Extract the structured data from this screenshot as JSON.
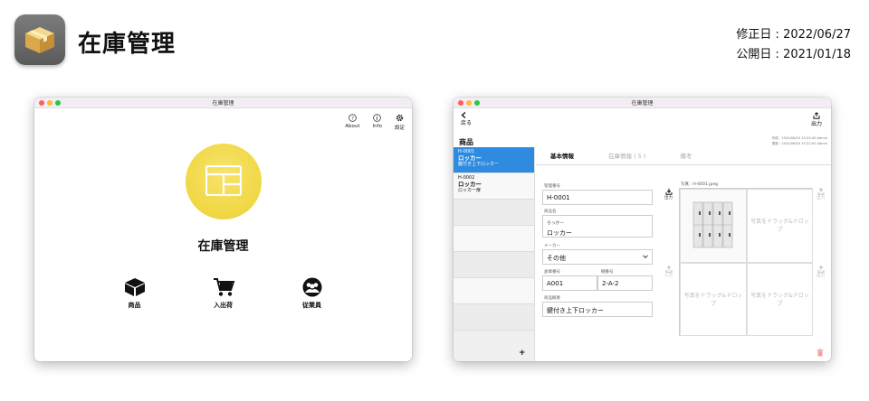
{
  "header": {
    "app_title": "在庫管理",
    "modified": "修正日 : 2022/06/27",
    "published": "公開日 : 2021/01/18"
  },
  "left_window": {
    "title": "在庫管理",
    "toolbar": [
      {
        "label": "About",
        "icon": "question-circle-icon"
      },
      {
        "label": "Info",
        "icon": "info-circle-icon"
      },
      {
        "label": "設定",
        "icon": "gear-icon"
      }
    ],
    "main_label": "在庫管理",
    "nav": [
      {
        "label": "商品",
        "icon": "box-icon"
      },
      {
        "label": "入出荷",
        "icon": "cart-icon"
      },
      {
        "label": "従業員",
        "icon": "people-icon"
      }
    ]
  },
  "right_window": {
    "title": "在庫管理",
    "back_label": "戻る",
    "output_label": "出力",
    "meta_lines": [
      "作成 : 2020/06/03 15:20:40 Admin",
      "更新 : 2020/06/03 15:22:02 Admin"
    ],
    "list_title": "商品",
    "items": [
      {
        "code": "H-0001",
        "name": "ロッカー",
        "desc": "鍵付き上下ロッカー",
        "selected": true
      },
      {
        "code": "H-0002",
        "name": "ロッカー",
        "desc": "ロッカー扉",
        "selected": false
      }
    ],
    "add_label": "+",
    "tabs": [
      "基本情報",
      "在庫情報 ( 5 )",
      "備考"
    ],
    "fields": {
      "mgmt_label": "管理番号",
      "mgmt_value": "H-0001",
      "name_label": "商品名",
      "name_kana": "ろっかー",
      "name_value": "ロッカー",
      "maker_label": "メーカー",
      "maker_value": "その他",
      "shelf_label": "倉庫番号",
      "shelf_value": "A001",
      "shelf2_label": "棚番号",
      "shelf2_value": "2-A-2",
      "detail_label": "商品概要",
      "detail_value": "鍵付き上下ロッカー"
    },
    "photo_label": "写真 : H-0001.jpeg",
    "photo_placeholder": "写真をドラッグ&ドロップ",
    "side_btn_output": "出力",
    "side_btn_output_dim": "出力",
    "side_btn_input": "入力"
  },
  "colors": {
    "accent_blue": "#2e8be0",
    "yellow": "#f0d83e",
    "titlebar": "#f4ecf4"
  }
}
